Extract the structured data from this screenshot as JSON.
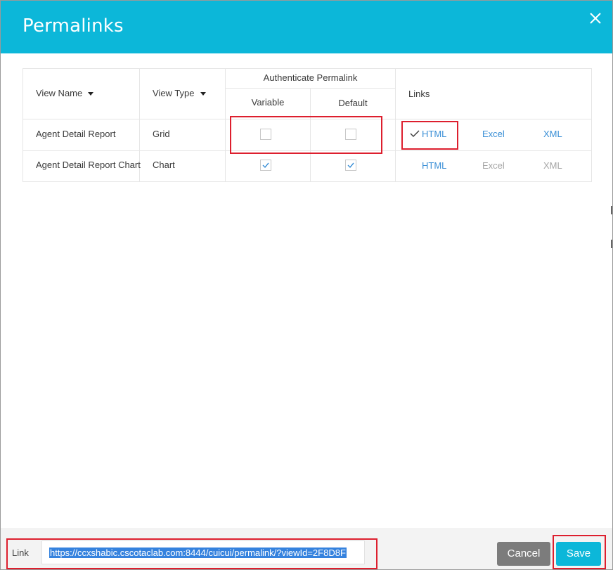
{
  "dialog": {
    "title": "Permalinks",
    "close_icon": "close-icon"
  },
  "table": {
    "headers": {
      "view_name": "View Name",
      "view_type": "View Type",
      "auth_group": "Authenticate Permalink",
      "variable": "Variable",
      "default": "Default",
      "links": "Links"
    },
    "rows": [
      {
        "view_name": "Agent Detail Report",
        "view_type": "Grid",
        "variable_checked": false,
        "default_checked": false,
        "links": {
          "html": "HTML",
          "excel": "Excel",
          "xml": "XML",
          "selected": "html"
        }
      },
      {
        "view_name": "Agent Detail Report Chart",
        "view_type": "Chart",
        "variable_checked": true,
        "default_checked": true,
        "links": {
          "html": "HTML",
          "excel": "Excel",
          "xml": "XML",
          "selected": ""
        }
      }
    ]
  },
  "footer": {
    "link_label": "Link",
    "link_value": "https://ccxshabic.cscotaclab.com:8444/cuicui/permalink/?viewId=2F8D8F",
    "cancel_label": "Cancel",
    "save_label": "Save"
  },
  "colors": {
    "header_bg": "#0cb7d9",
    "accent_link": "#3a8fd6",
    "disabled_link": "#a5a5a5",
    "highlight_box": "#dd1f2e",
    "cancel_bg": "#7c7c7c",
    "save_bg": "#0cb7d9"
  }
}
